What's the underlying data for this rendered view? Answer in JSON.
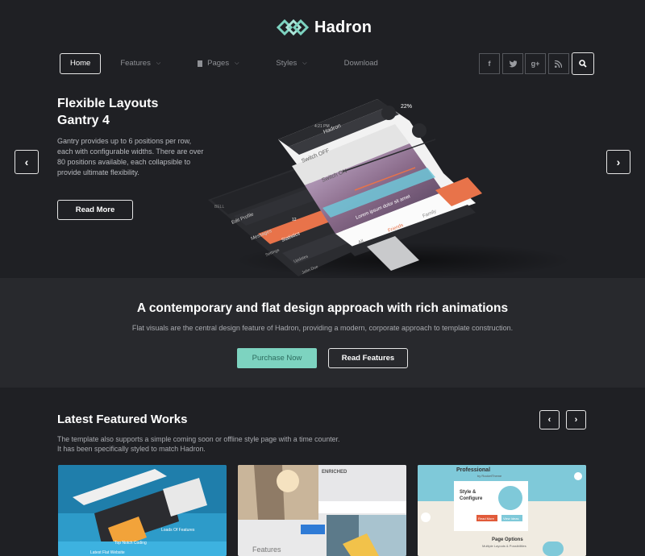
{
  "brand": {
    "name": "Hadron",
    "accent": "#7dd3c0"
  },
  "nav": {
    "items": [
      {
        "label": "Home",
        "active": true
      },
      {
        "label": "Features",
        "dropdown": true
      },
      {
        "label": "Pages",
        "dropdown": true,
        "icon": "page-icon"
      },
      {
        "label": "Styles",
        "dropdown": true
      },
      {
        "label": "Download"
      }
    ]
  },
  "social": {
    "facebook": "f",
    "twitter": "twitter-icon",
    "googleplus": "g+",
    "rss": "rss-icon",
    "search": "search-icon"
  },
  "slide": {
    "title_line1": "Flexible Layouts",
    "title_line2": "Gantry 4",
    "description": "Gantry provides up to 6 positions per row, each with configurable widths. There are over 80 positions available, each collapsible to provide ultimate flexibility.",
    "button": "Read More",
    "mockup": {
      "status_carrier": "BELL",
      "status_time": "4:21 PM",
      "status_battery": "22%",
      "app_title": "Hadron",
      "menu_items": [
        "Edit Profile",
        "Messages",
        "Settings",
        "Statistics",
        "Updates",
        "John Doe"
      ],
      "messages_badge": "12",
      "toggle_off": "Switch OFF",
      "toggle_on": "Switch ON",
      "caption": "Lorem ipsum dolor sit amet",
      "tabs": [
        "All",
        "Friends",
        "Family"
      ]
    }
  },
  "band": {
    "title": "A contemporary and flat design approach with rich animations",
    "subtitle": "Flat visuals are the central design feature of Hadron, providing a modern, corporate approach to template construction.",
    "primary_button": "Purchase Now",
    "secondary_button": "Read Features"
  },
  "works": {
    "title": "Latest Featured Works",
    "description_line1": "The template also supports a simple coming soon or offline style page with a time counter.",
    "description_line2": "It has been specifically styled to match Hadron.",
    "thumbs": [
      {
        "labels": [
          "Top Notch Coding",
          "Loads Of Features",
          "Latest Flat Website"
        ]
      },
      {
        "labels": [
          "ENRICHED",
          "Features"
        ]
      },
      {
        "labels": [
          "Professional",
          "by RocketTheme",
          "Style &",
          "Configure",
          "Read More",
          "View Ideas",
          "Page Options",
          "Multiple Layouts & Possibilities"
        ]
      }
    ]
  }
}
